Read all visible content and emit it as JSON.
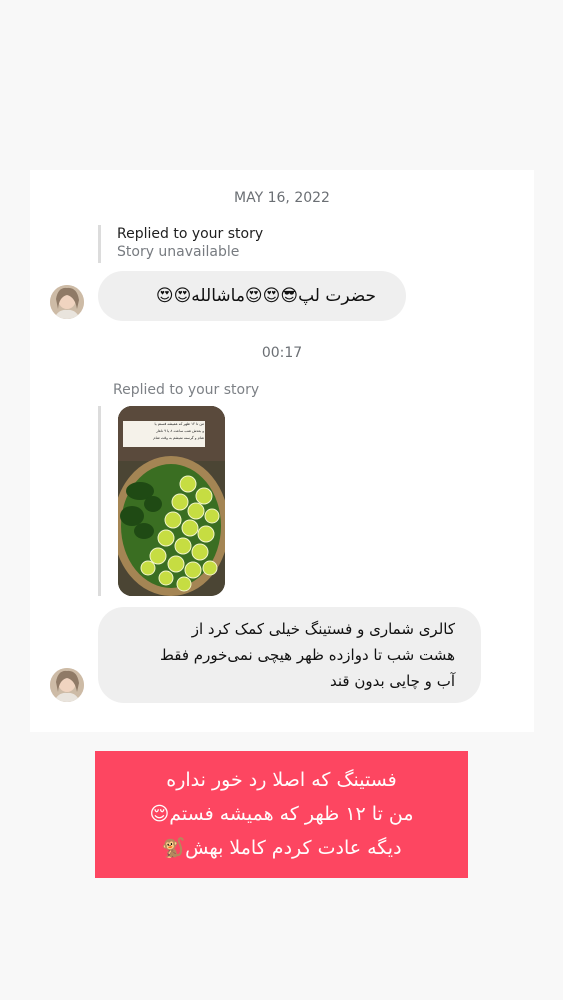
{
  "chat": {
    "date_header": "MAY 16, 2022",
    "time_header": "00:17",
    "reply1": {
      "title": "Replied to your story",
      "subtitle": "Story unavailable"
    },
    "message1": "حضرت لپ😎😍😍ماشالله😍😍",
    "reply2": {
      "title": "Replied to your story"
    },
    "story_thumb": {
      "caption_lines": [
        "من تا ۱۲ ظهر که همیشه فستم یا",
        "و بعدش شب ساعت ۸ یا ۹ ناهار",
        "شام و گرسنه نمیشم به وقت شام"
      ]
    },
    "message2": {
      "lines": [
        "کالری شماری و فستینگ خیلی کمک کرد از",
        "هشت شب تا دوازده ظهر هیچی نمی‌خورم فقط",
        "آب و چایی بدون قند"
      ]
    }
  },
  "caption": {
    "lines": [
      "فستینگ که اصلا رد خور نداره",
      "من تا ۱۲ ظهر که همیشه فستم😌",
      "دیگه عادت کردم کاملا بهش🐒"
    ]
  }
}
